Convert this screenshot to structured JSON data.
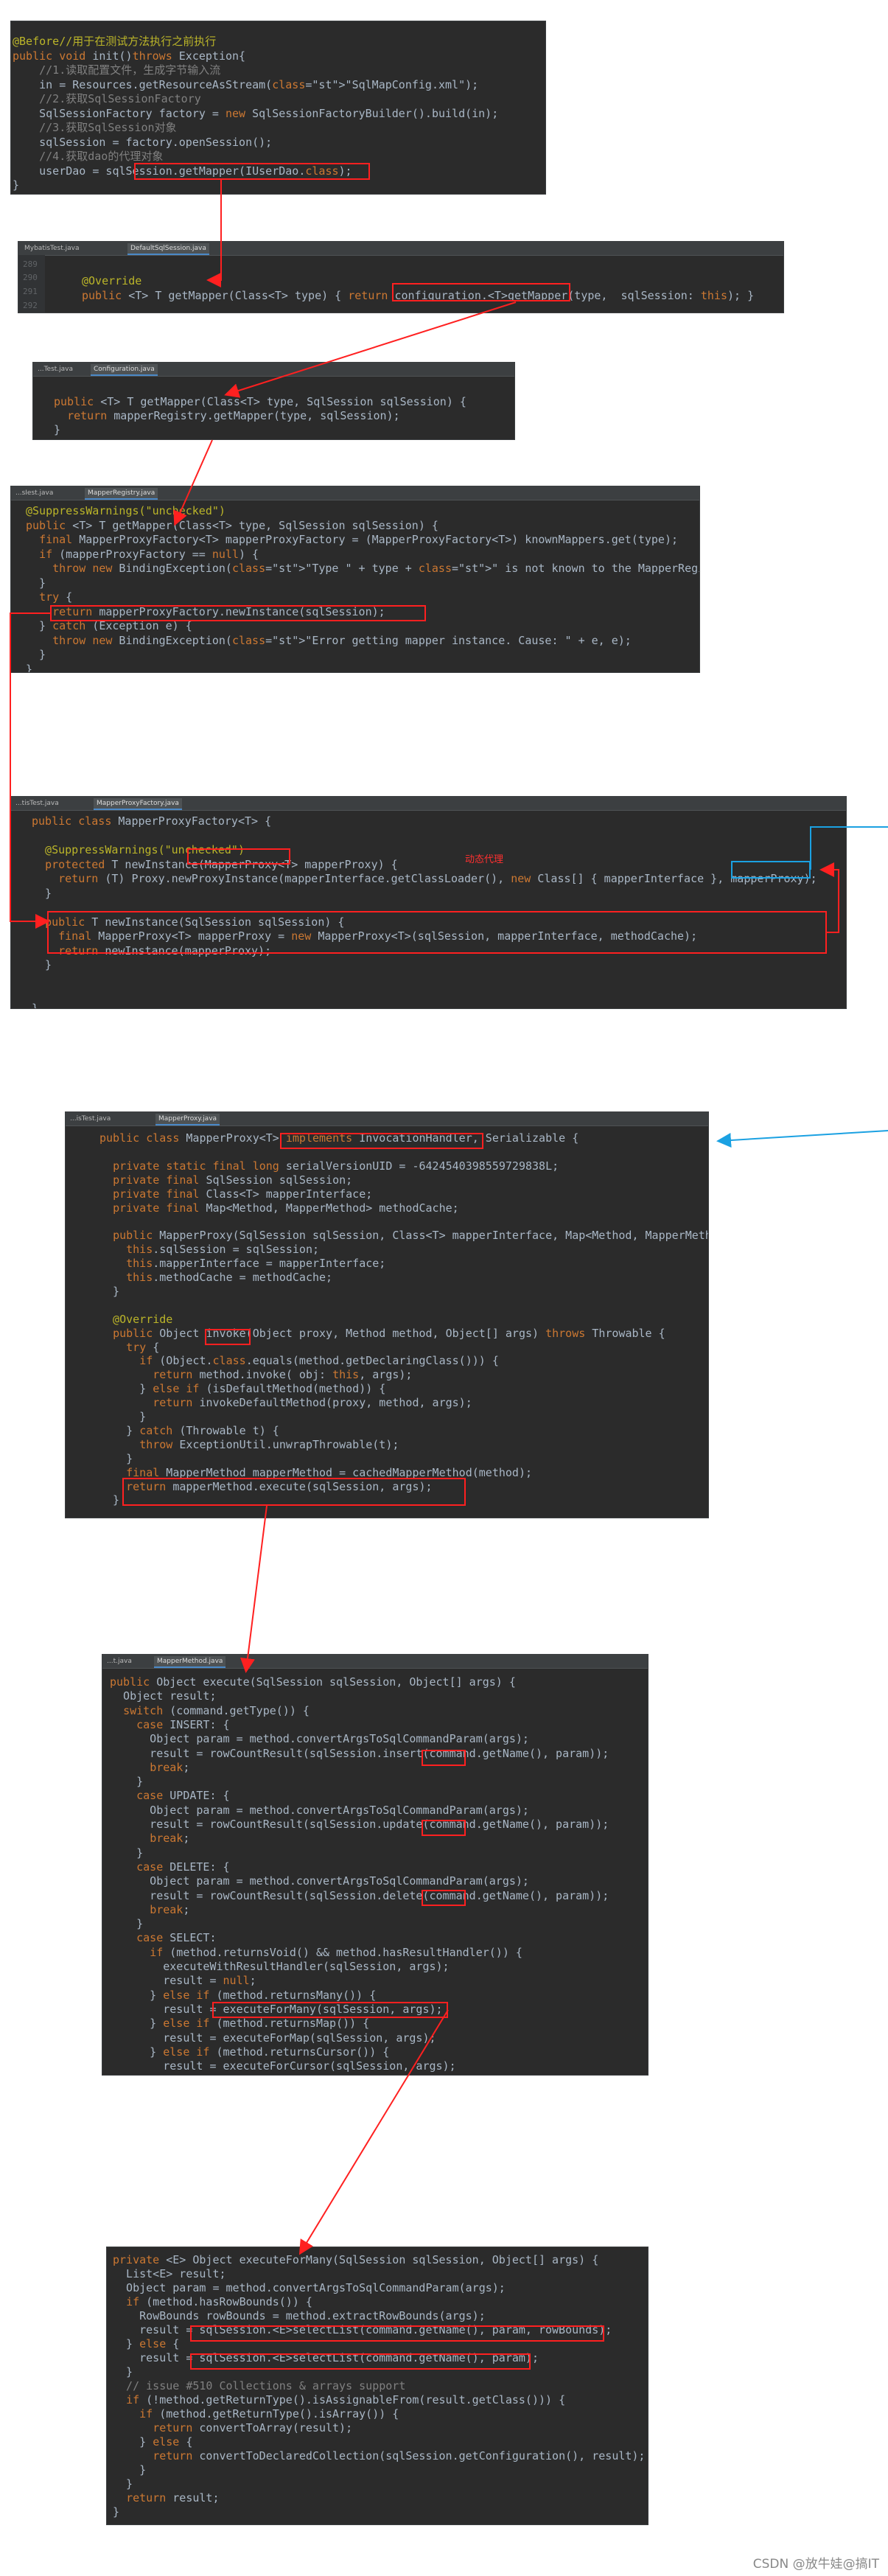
{
  "panels": {
    "p1": {
      "lines": [
        "@Before//用于在测试方法执行之前执行",
        "public void init()throws Exception{",
        "    //1.读取配置文件，生成字节输入流",
        "    in = Resources.getResourceAsStream(\"SqlMapConfig.xml\");",
        "    //2.获取SqlSessionFactory",
        "    SqlSessionFactory factory = new SqlSessionFactoryBuilder().build(in);",
        "    //3.获取SqlSession对象",
        "    sqlSession = factory.openSession();",
        "    //4.获取dao的代理对象",
        "    userDao = sqlSession.getMapper(IUserDao.class);",
        "}"
      ]
    },
    "p2": {
      "tabs": [
        "MybatisTest.java",
        "DefaultSqlSession.java"
      ],
      "gutter": [
        "289",
        "290",
        "291",
        "292"
      ],
      "lines": [
        "@Override",
        "public <T> T getMapper(Class<T> type) { return configuration.<T>getMapper(type,  sqlSession: this); }"
      ]
    },
    "p3": {
      "tabs": [
        "...Test.java",
        "Configuration.java"
      ],
      "lines": [
        "public <T> T getMapper(Class<T> type, SqlSession sqlSession) {",
        "  return mapperRegistry.getMapper(type, sqlSession);",
        "}"
      ]
    },
    "p4": {
      "tabs": [
        "...sIest.java",
        "MapperRegistry.java"
      ],
      "lines": [
        "@SuppressWarnings(\"unchecked\")",
        "public <T> T getMapper(Class<T> type, SqlSession sqlSession) {",
        "  final MapperProxyFactory<T> mapperProxyFactory = (MapperProxyFactory<T>) knownMappers.get(type);",
        "  if (mapperProxyFactory == null) {",
        "    throw new BindingException(\"Type \" + type + \" is not known to the MapperRegistry.\");",
        "  }",
        "  try {",
        "    return mapperProxyFactory.newInstance(sqlSession);",
        "  } catch (Exception e) {",
        "    throw new BindingException(\"Error getting mapper instance. Cause: \" + e, e);",
        "  }",
        "}"
      ]
    },
    "p5": {
      "tabs": [
        "...tisTest.java",
        "MapperProxyFactory.java"
      ],
      "lines": [
        "public class MapperProxyFactory<T> {",
        "",
        "  @SuppressWarnings(\"unchecked\")",
        "  protected T newInstance(MapperProxy<T> mapperProxy) {",
        "    return (T) Proxy.newProxyInstance(mapperInterface.getClassLoader(), new Class[] { mapperInterface }, mapperProxy);",
        "  }",
        "",
        "  public T newInstance(SqlSession sqlSession) {",
        "    final MapperProxy<T> mapperProxy = new MapperProxy<T>(sqlSession, mapperInterface, methodCache);",
        "    return newInstance(mapperProxy);",
        "  }",
        "",
        "",
        "}"
      ],
      "annotation": "动态代理"
    },
    "p6": {
      "tabs": [
        "...isTest.java",
        "MapperProxy.java"
      ],
      "lines": [
        "public class MapperProxy<T> implements InvocationHandler, Serializable {",
        "",
        "  private static final long serialVersionUID = -6424540398559729838L;",
        "  private final SqlSession sqlSession;",
        "  private final Class<T> mapperInterface;",
        "  private final Map<Method, MapperMethod> methodCache;",
        "",
        "  public MapperProxy(SqlSession sqlSession, Class<T> mapperInterface, Map<Method, MapperMeth",
        "    this.sqlSession = sqlSession;",
        "    this.mapperInterface = mapperInterface;",
        "    this.methodCache = methodCache;",
        "  }",
        "",
        "  @Override",
        "  public Object invoke(Object proxy, Method method, Object[] args) throws Throwable {",
        "    try {",
        "      if (Object.class.equals(method.getDeclaringClass())) {",
        "        return method.invoke( obj: this, args);",
        "      } else if (isDefaultMethod(method)) {",
        "        return invokeDefaultMethod(proxy, method, args);",
        "      }",
        "    } catch (Throwable t) {",
        "      throw ExceptionUtil.unwrapThrowable(t);",
        "    }",
        "    final MapperMethod mapperMethod = cachedMapperMethod(method);",
        "    return mapperMethod.execute(sqlSession, args);",
        "  }"
      ]
    },
    "p7": {
      "tabs": [
        "...t.java",
        "MapperMethod.java"
      ],
      "lines": [
        "public Object execute(SqlSession sqlSession, Object[] args) {",
        "  Object result;",
        "  switch (command.getType()) {",
        "    case INSERT: {",
        "      Object param = method.convertArgsToSqlCommandParam(args);",
        "      result = rowCountResult(sqlSession.insert(command.getName(), param));",
        "      break;",
        "    }",
        "    case UPDATE: {",
        "      Object param = method.convertArgsToSqlCommandParam(args);",
        "      result = rowCountResult(sqlSession.update(command.getName(), param));",
        "      break;",
        "    }",
        "    case DELETE: {",
        "      Object param = method.convertArgsToSqlCommandParam(args);",
        "      result = rowCountResult(sqlSession.delete(command.getName(), param));",
        "      break;",
        "    }",
        "    case SELECT:",
        "      if (method.returnsVoid() && method.hasResultHandler()) {",
        "        executeWithResultHandler(sqlSession, args);",
        "        result = null;",
        "      } else if (method.returnsMany()) {",
        "        result = executeForMany(sqlSession, args);",
        "      } else if (method.returnsMap()) {",
        "        result = executeForMap(sqlSession, args);",
        "      } else if (method.returnsCursor()) {",
        "        result = executeForCursor(sqlSession, args);"
      ]
    },
    "p8": {
      "lines": [
        "private <E> Object executeForMany(SqlSession sqlSession, Object[] args) {",
        "  List<E> result;",
        "  Object param = method.convertArgsToSqlCommandParam(args);",
        "  if (method.hasRowBounds()) {",
        "    RowBounds rowBounds = method.extractRowBounds(args);",
        "    result = sqlSession.<E>selectList(command.getName(), param, rowBounds);",
        "  } else {",
        "    result = sqlSession.<E>selectList(command.getName(), param);",
        "  }",
        "  // issue #510 Collections & arrays support",
        "  if (!method.getReturnType().isAssignableFrom(result.getClass())) {",
        "    if (method.getReturnType().isArray()) {",
        "      return convertToArray(result);",
        "    } else {",
        "      return convertToDeclaredCollection(sqlSession.getConfiguration(), result);",
        "    }",
        "  }",
        "  return result;",
        "}"
      ]
    }
  },
  "watermark": "CSDN @放牛娃@搞IT",
  "colors": {
    "panel_bg": "#2b2b2b",
    "arrow_red": "#ff2020",
    "arrow_blue": "#1ba1e2",
    "keyword": "#cc7832",
    "method": "#ffc66d",
    "string": "#6a8759",
    "comment": "#808080",
    "field": "#9876aa"
  }
}
